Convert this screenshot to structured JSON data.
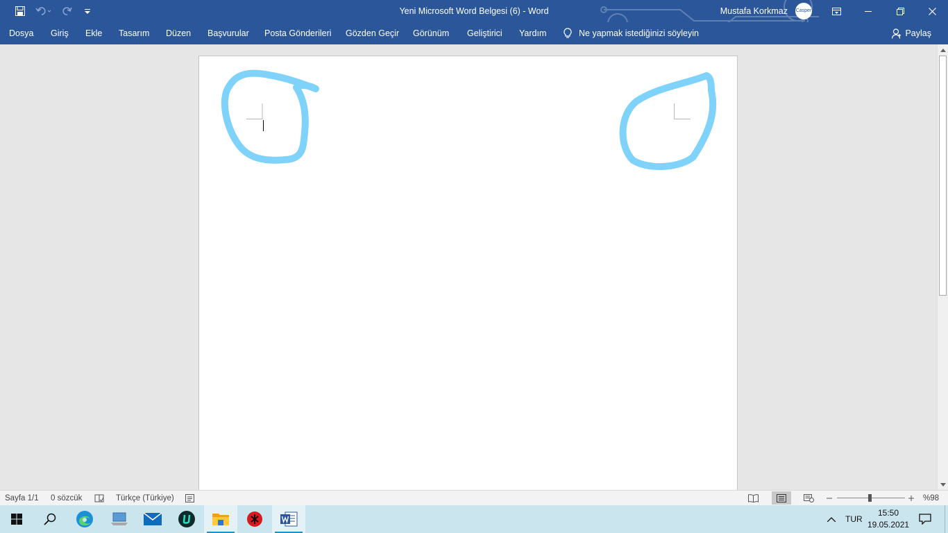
{
  "title_bar": {
    "document_title": "Yeni Microsoft Word Belgesi (6)  -  Word",
    "user_name": "Mustafa Korkmaz",
    "avatar_text": "Casper",
    "icons": [
      "save-icon",
      "undo-icon",
      "redo-icon",
      "customize-quick-access-icon",
      "ribbon-display-options-icon",
      "minimize-icon",
      "restore-icon",
      "close-icon"
    ],
    "brand_color": "#2b579a"
  },
  "ribbon": {
    "tabs": [
      "Dosya",
      "Giriş",
      "Ekle",
      "Tasarım",
      "Düzen",
      "Başvurular",
      "Posta Gönderileri",
      "Gözden Geçir",
      "Görünüm",
      "Geliştirici",
      "Yardım"
    ],
    "tell_me": "Ne yapmak istediğinizi söyleyin",
    "share": "Paylaş"
  },
  "document": {
    "ink_color": "#7fd3fb",
    "annotations": [
      "circle-around-top-left-margin-mark",
      "circle-around-top-right-margin-mark"
    ]
  },
  "status_bar": {
    "page": "Sayfa 1/1",
    "words": "0 sözcük",
    "language": "Türkçe (Türkiye)",
    "zoom": "%98",
    "zoom_percent": 98
  },
  "taskbar": {
    "apps": [
      "start-icon",
      "search-icon",
      "edge-icon",
      "laptop-icon",
      "mail-icon",
      "ubisoft-icon",
      "file-explorer-icon",
      "gaming-app-icon",
      "word-icon"
    ],
    "language": "TUR",
    "time": "15:50",
    "date": "19.05.2021"
  }
}
